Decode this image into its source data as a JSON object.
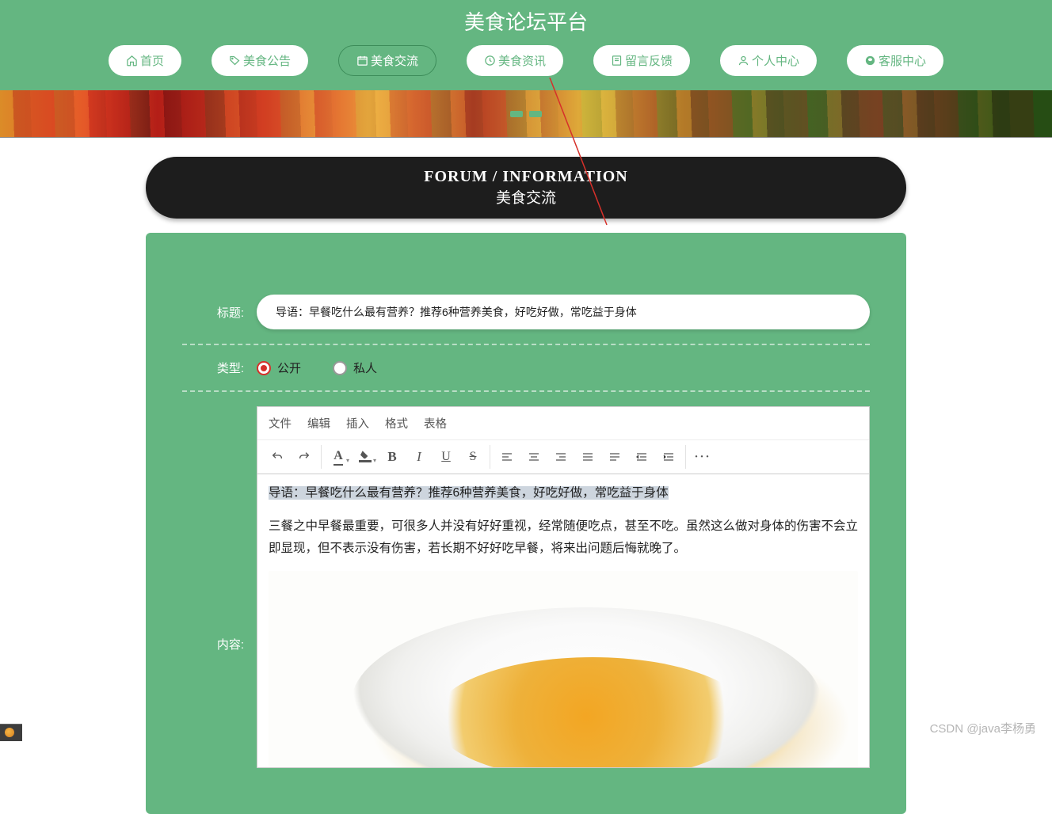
{
  "site": {
    "title": "美食论坛平台"
  },
  "nav": [
    {
      "label": "首页",
      "icon": "home"
    },
    {
      "label": "美食公告",
      "icon": "tag"
    },
    {
      "label": "美食交流",
      "icon": "calendar",
      "active": true
    },
    {
      "label": "美食资讯",
      "icon": "clock"
    },
    {
      "label": "留言反馈",
      "icon": "note"
    },
    {
      "label": "个人中心",
      "icon": "user"
    },
    {
      "label": "客服中心",
      "icon": "chat"
    }
  ],
  "section": {
    "en": "FORUM / INFORMATION",
    "cn": "美食交流"
  },
  "form": {
    "title_label": "标题:",
    "title_value": "导语：早餐吃什么最有营养？推荐6种营养美食，好吃好做，常吃益于身体",
    "type_label": "类型:",
    "type_options": [
      {
        "label": "公开",
        "checked": true
      },
      {
        "label": "私人",
        "checked": false
      }
    ],
    "content_label": "内容:"
  },
  "editor": {
    "menu": [
      "文件",
      "编辑",
      "插入",
      "格式",
      "表格"
    ],
    "body": {
      "line1": "导语：早餐吃什么最有营养？推荐6种营养美食，好吃好做，常吃益于身体",
      "para1": "三餐之中早餐最重要，可很多人并没有好好重视，经常随便吃点，甚至不吃。虽然这么做对身体的伤害不会立即显现，但不表示没有伤害，若长期不好好吃早餐，将来出问题后悔就晚了。"
    }
  },
  "watermark": "CSDN @java李杨勇"
}
